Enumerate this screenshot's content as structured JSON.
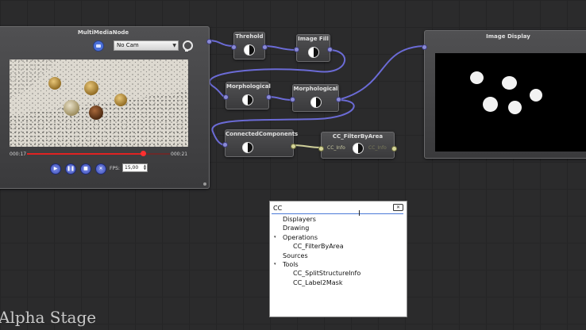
{
  "nodes": {
    "multimedia": {
      "title": "MultiMediaNode",
      "camera_select": "No Cam",
      "time_elapsed": "000:17",
      "time_total": "000:21",
      "playback_progress": 0.81,
      "fps_label": "FPS:",
      "fps_value": "15,00",
      "icons": [
        "camera-icon",
        "chevron-down-icon",
        "bulb-icon",
        "play-icon",
        "pause-icon",
        "stop-icon",
        "record-icon",
        "spinner-icon"
      ]
    },
    "threshold": {
      "title": "Threhold"
    },
    "image_fill": {
      "title": "Image Fill"
    },
    "morph1": {
      "title": "Morphological"
    },
    "morph2": {
      "title": "Morphological"
    },
    "connected": {
      "title": "ConnectedComponents"
    },
    "filter": {
      "title": "CC_FilterByArea",
      "in_label": "CC_Info",
      "out_label": "CC_Info"
    },
    "display": {
      "title": "Image Display"
    }
  },
  "search": {
    "query": "CC",
    "clear_icon": "backspace-icon",
    "tree": [
      {
        "label": "Displayers",
        "level": 0,
        "expander": ""
      },
      {
        "label": "Drawing",
        "level": 0,
        "expander": ""
      },
      {
        "label": "Operations",
        "level": 0,
        "expander": "▾"
      },
      {
        "label": "CC_FilterByArea",
        "level": 1,
        "expander": ""
      },
      {
        "label": "Sources",
        "level": 0,
        "expander": ""
      },
      {
        "label": "Tools",
        "level": 0,
        "expander": "▾"
      },
      {
        "label": "CC_SplitStructureInfo",
        "level": 1,
        "expander": ""
      },
      {
        "label": "CC_Label2Mask",
        "level": 1,
        "expander": ""
      }
    ]
  },
  "watermark": "Alpha Stage",
  "colors": {
    "canvas": "#2b2b2c",
    "wire": "#6b6bd6",
    "info_wire": "#d0d09a",
    "timeline_progress": "#e02222",
    "control_button": "#5b6fd6"
  }
}
